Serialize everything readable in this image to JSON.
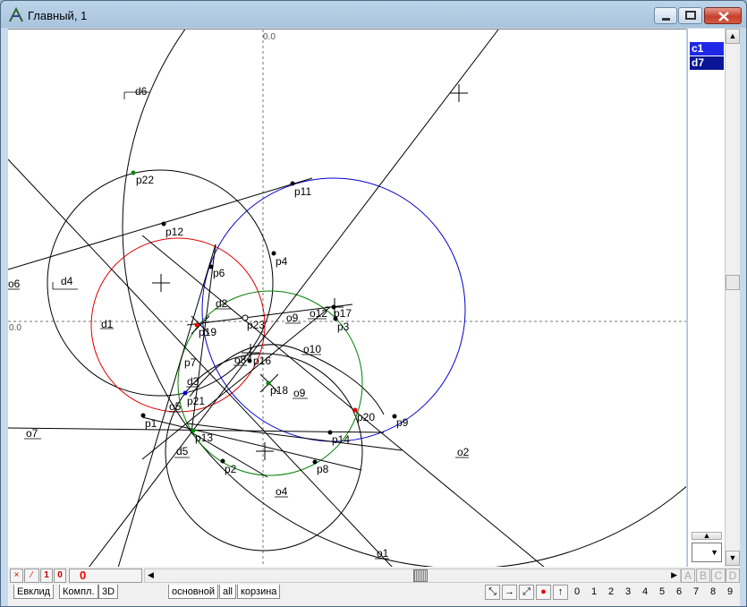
{
  "window": {
    "title": "Главный, 1"
  },
  "axis_labels": {
    "x_zero": "0.0",
    "y_zero": "0.0"
  },
  "points": [
    {
      "label": "p1"
    },
    {
      "label": "p2"
    },
    {
      "label": "p3"
    },
    {
      "label": "p4"
    },
    {
      "label": "p6"
    },
    {
      "label": "p7"
    },
    {
      "label": "p8"
    },
    {
      "label": "p9"
    },
    {
      "label": "p11"
    },
    {
      "label": "p12"
    },
    {
      "label": "p13"
    },
    {
      "label": "p14"
    },
    {
      "label": "p16"
    },
    {
      "label": "p17"
    },
    {
      "label": "p18"
    },
    {
      "label": "p19"
    },
    {
      "label": "p20"
    },
    {
      "label": "p21"
    },
    {
      "label": "p22"
    },
    {
      "label": "p23"
    }
  ],
  "objects": [
    {
      "label": "d1"
    },
    {
      "label": "d2"
    },
    {
      "label": "d3"
    },
    {
      "label": "d4"
    },
    {
      "label": "d5"
    },
    {
      "label": "d6"
    },
    {
      "label": "o1"
    },
    {
      "label": "o2"
    },
    {
      "label": "o3"
    },
    {
      "label": "o4"
    },
    {
      "label": "o5"
    },
    {
      "label": "o6"
    },
    {
      "label": "o7"
    },
    {
      "label": "o8"
    },
    {
      "label": "o9"
    },
    {
      "label": "o10"
    },
    {
      "label": "o12"
    }
  ],
  "layers": [
    "c1",
    "d7"
  ],
  "bottom": {
    "counter": "0",
    "small_buttons": [
      "×",
      "⁄",
      "1",
      "0"
    ],
    "tabs_left": [
      "Евклид",
      "Компл.",
      "3D"
    ],
    "tabs_right": [
      "основной",
      "all",
      "корзина"
    ],
    "abcd": [
      "A",
      "B",
      "C",
      "D"
    ],
    "digits": [
      "0",
      "1",
      "2",
      "3",
      "4",
      "5",
      "6",
      "7",
      "8",
      "9"
    ]
  },
  "colors": {
    "accent": "#1e28e6",
    "red": "#e00000",
    "green": "#008000",
    "blue": "#0000cc"
  }
}
